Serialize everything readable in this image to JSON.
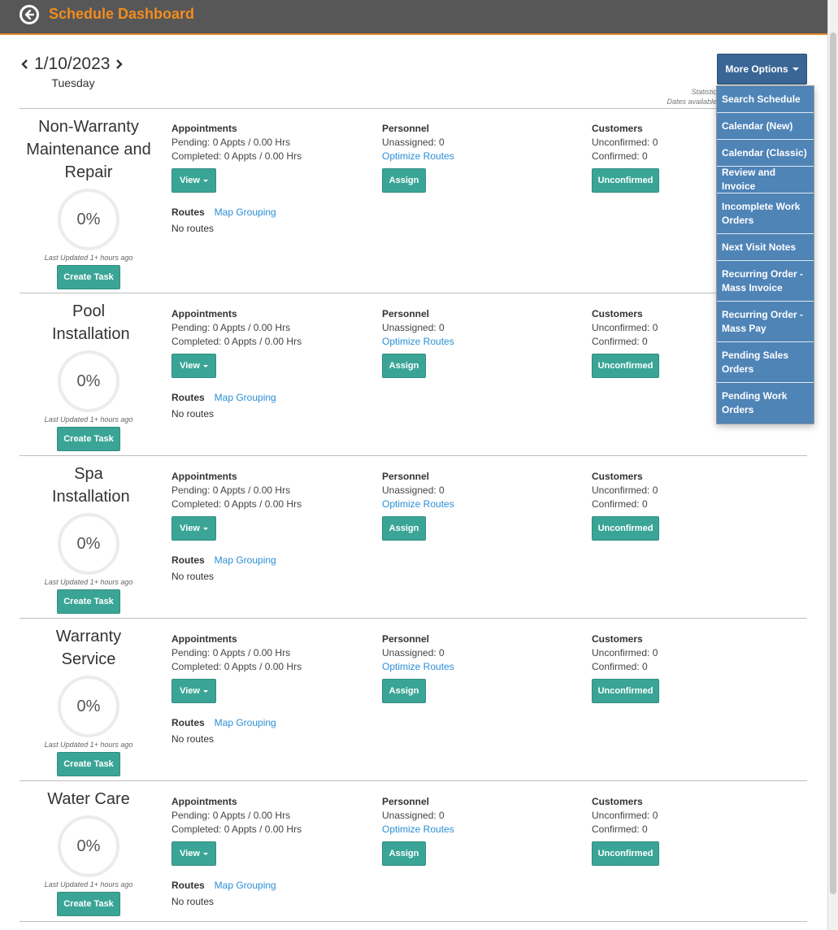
{
  "header": {
    "title": "Schedule Dashboard",
    "back_icon": "back-arrow-circle-icon"
  },
  "date": {
    "value": "1/10/2023",
    "weekday": "Tuesday"
  },
  "more_options": {
    "label": "More Options",
    "note_line1": "Statistic",
    "note_line2": "Dates available",
    "items": [
      "Search Schedule",
      "Calendar (New)",
      "Calendar (Classic)",
      "Review and Invoice",
      "Incomplete Work Orders",
      "Next Visit Notes",
      "Recurring Order - Mass Invoice",
      "Recurring Order - Mass Pay",
      "Pending Sales Orders",
      "Pending Work Orders"
    ]
  },
  "labels": {
    "appointments": "Appointments",
    "personnel": "Personnel",
    "customers": "Customers",
    "routes": "Routes",
    "map_grouping": "Map Grouping",
    "no_routes": "No routes",
    "view": "View",
    "assign": "Assign",
    "unconfirmed": "Unconfirmed",
    "optimize_routes": "Optimize Routes",
    "create_task": "Create Task",
    "last_updated": "Last Updated 1+ hours ago"
  },
  "colors": {
    "accent_orange": "#f28c1e",
    "teal": "#3aa596",
    "dropdown_blue": "#4f84b7",
    "button_blue": "#3a6696",
    "link": "#2a8fd6"
  },
  "sections": [
    {
      "name": "Non-Warranty Maintenance and Repair",
      "percent": "0%",
      "pending": "Pending: 0 Appts / 0.00 Hrs",
      "completed": "Completed: 0 Appts / 0.00 Hrs",
      "unassigned": "Unassigned: 0",
      "unconfirmed": "Unconfirmed: 0",
      "confirmed": "Confirmed: 0"
    },
    {
      "name": "Pool Installation",
      "percent": "0%",
      "pending": "Pending: 0 Appts / 0.00 Hrs",
      "completed": "Completed: 0 Appts / 0.00 Hrs",
      "unassigned": "Unassigned: 0",
      "unconfirmed": "Unconfirmed: 0",
      "confirmed": "Confirmed: 0"
    },
    {
      "name": "Spa Installation",
      "percent": "0%",
      "pending": "Pending: 0 Appts / 0.00 Hrs",
      "completed": "Completed: 0 Appts / 0.00 Hrs",
      "unassigned": "Unassigned: 0",
      "unconfirmed": "Unconfirmed: 0",
      "confirmed": "Confirmed: 0"
    },
    {
      "name": "Warranty Service",
      "percent": "0%",
      "pending": "Pending: 0 Appts / 0.00 Hrs",
      "completed": "Completed: 0 Appts / 0.00 Hrs",
      "unassigned": "Unassigned: 0",
      "unconfirmed": "Unconfirmed: 0",
      "confirmed": "Confirmed: 0"
    },
    {
      "name": "Water Care",
      "percent": "0%",
      "pending": "Pending: 0 Appts / 0.00 Hrs",
      "completed": "Completed: 0 Appts / 0.00 Hrs",
      "unassigned": "Unassigned: 0",
      "unconfirmed": "Unconfirmed: 0",
      "confirmed": "Confirmed: 0"
    }
  ]
}
